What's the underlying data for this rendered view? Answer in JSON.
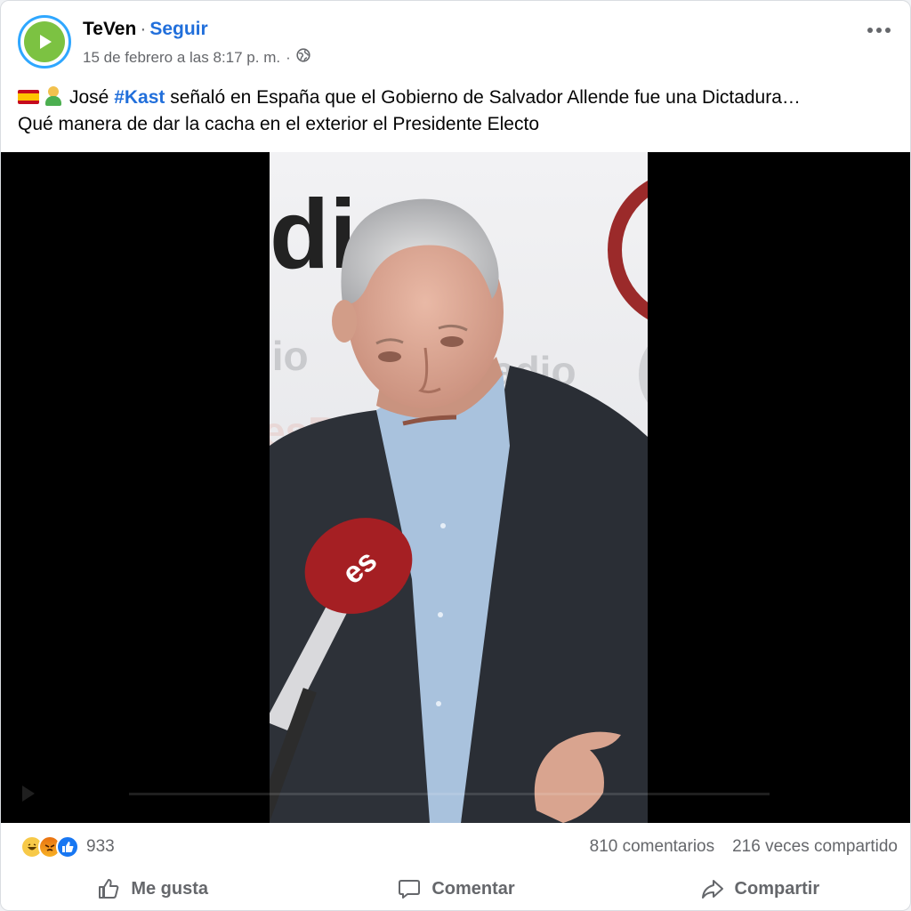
{
  "post": {
    "page_name": "TeVen",
    "separator": "·",
    "follow_label": "Seguir",
    "timestamp": "15 de febrero a las 8:17 p. m.",
    "meta_separator": "·",
    "caption_part1": "José ",
    "hashtag": "#Kast",
    "caption_part2": " señaló en España que el Gobierno de Salvador Allende fue una Dictadura…",
    "caption_line2": "Qué manera de dar la cacha en el exterior el Presidente Electo"
  },
  "video": {
    "background_text_top": "di",
    "background_text_left": "lio",
    "background_text_right": "adio",
    "background_text_bottom": "esR",
    "mic_logo": "es"
  },
  "stats": {
    "reactions_count": "933",
    "comments": "810 comentarios",
    "shares": "216 veces compartido"
  },
  "actions": {
    "like_label": "Me gusta",
    "comment_label": "Comentar",
    "share_label": "Compartir"
  },
  "colors": {
    "link_blue": "#216fdb",
    "like_blue": "#1877f2",
    "muted": "#65676b",
    "avatar_ring": "#2fa7ff",
    "avatar_green": "#7cc242"
  },
  "icons": {
    "avatar": "play-icon",
    "privacy": "globe-icon",
    "more": "more-options-icon",
    "like": "thumbs-up-icon",
    "comment": "comment-bubble-icon",
    "share": "share-arrow-icon"
  }
}
